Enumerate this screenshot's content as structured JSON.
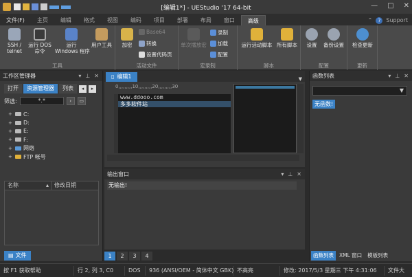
{
  "window": {
    "title": "[编辑1*] - UEStudio '17 64-bit",
    "controls": {
      "minimize": "—",
      "maximize": "□",
      "close": "✕"
    }
  },
  "ribbon_tabs": {
    "items": [
      "文件(F)",
      "主页",
      "编辑",
      "格式",
      "视图",
      "编码",
      "项目",
      "高级",
      "布局",
      "窗口",
      "高级"
    ],
    "active_index": 10,
    "support": "Support",
    "help": "?"
  },
  "ribbon": {
    "groups": {
      "tools": "工具",
      "active_files": "活动文件",
      "macros": "宏录制",
      "scripts": "脚本",
      "config": "配置",
      "update": "更新"
    },
    "buttons": {
      "ssh": "SSH /\ntelnet",
      "run_dos": "运行 DOS\n命令",
      "run_windows": "运行\nWindows 程序",
      "user_tools": "用户工具",
      "encrypt": "加密",
      "base64": "Base64",
      "convert": "转换",
      "set_codepage": "设置代码页",
      "single_play": "单次播放宏",
      "record": "录制",
      "load": "加载",
      "configure": "配置",
      "run_active_script": "运行活动脚本",
      "all_scripts": "所有脚本",
      "settings": "设置",
      "backup_settings": "备份设置",
      "check_updates": "检查更新"
    }
  },
  "left_panel": {
    "title": "工作区管理器",
    "tabs": [
      "打开",
      "资源管理器",
      "列表"
    ],
    "active_tab": 1,
    "filter_label": "筛选:",
    "filter_value": "*.*",
    "tree": [
      "C:",
      "D:",
      "E:",
      "F:",
      "网络",
      "FTP 帐号"
    ],
    "columns": [
      "名称",
      "修改日期"
    ],
    "bottom_tab": "文件"
  },
  "editor": {
    "doc_tab": "编辑1",
    "ruler": "0,,,,,,,,,10,,,,,,,,,20,,,,,,,,,30",
    "lines": [
      "www.ddooo.com",
      "多多软件站"
    ],
    "selected_line": 1
  },
  "output": {
    "title": "输出窗口",
    "text": "无输出!",
    "pages": [
      "1",
      "2",
      "3",
      "4"
    ],
    "active_page": 0
  },
  "right_panel": {
    "title": "函数列表",
    "badge": "无函数!",
    "bottom_tabs": [
      "函数列表",
      "XML 窗口",
      "模板列表"
    ],
    "active_tab": 0
  },
  "status": {
    "help": "按 F1 获取帮助",
    "position": "行 2, 列 3, C0",
    "line_ending": "DOS",
    "encoding": "936  (ANSI/OEM - 简体中文 GBK)",
    "highlight": "不高亮",
    "modified": "修改: 2017/5/3 星期三 下午 4:31:06",
    "file_size": "文件大"
  },
  "colors": {
    "accent": "#3b82c6",
    "background": "#2b2b2b",
    "ribbon": "#4a4a4a",
    "editor_bg": "#1b1b1b"
  }
}
